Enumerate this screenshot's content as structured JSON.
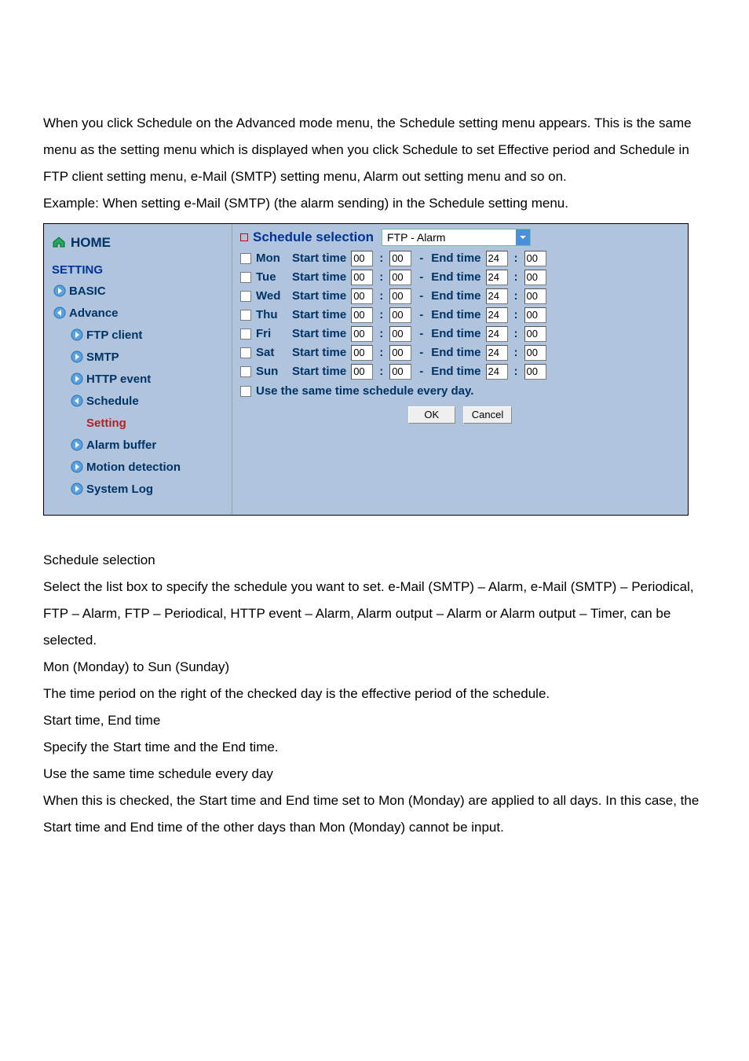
{
  "intro": {
    "p1": "When you click Schedule on the Advanced mode menu, the Schedule setting menu appears. This is the same menu as the setting menu which is displayed when you click Schedule to set Effective period and Schedule in FTP client setting menu, e-Mail (SMTP) setting menu, Alarm out setting menu and so on.",
    "p2": "Example: When setting e-Mail (SMTP) (the alarm sending) in the Schedule setting menu."
  },
  "sidebar": {
    "home": "HOME",
    "setting": "SETTING",
    "items": [
      {
        "label": "BASIC",
        "sub": false,
        "open": false,
        "current": false
      },
      {
        "label": "Advance",
        "sub": false,
        "open": true,
        "current": false
      },
      {
        "label": "FTP client",
        "sub": true,
        "open": false,
        "current": false
      },
      {
        "label": "SMTP",
        "sub": true,
        "open": false,
        "current": false
      },
      {
        "label": "HTTP event",
        "sub": true,
        "open": false,
        "current": false
      },
      {
        "label": "Schedule",
        "sub": true,
        "open": true,
        "current": false
      },
      {
        "label": "Setting",
        "sub": true,
        "open": false,
        "current": true,
        "noicon": true
      },
      {
        "label": "Alarm buffer",
        "sub": true,
        "open": false,
        "current": false
      },
      {
        "label": "Motion detection",
        "sub": true,
        "open": false,
        "current": false
      },
      {
        "label": "System Log",
        "sub": true,
        "open": false,
        "current": false
      }
    ]
  },
  "content": {
    "title": "Schedule selection",
    "dropdown_value": "FTP - Alarm",
    "start_label": "Start time",
    "end_label": "End time",
    "colon": ":",
    "dash": "-",
    "days": [
      {
        "day": "Mon",
        "sh": "00",
        "sm": "00",
        "eh": "24",
        "em": "00"
      },
      {
        "day": "Tue",
        "sh": "00",
        "sm": "00",
        "eh": "24",
        "em": "00"
      },
      {
        "day": "Wed",
        "sh": "00",
        "sm": "00",
        "eh": "24",
        "em": "00"
      },
      {
        "day": "Thu",
        "sh": "00",
        "sm": "00",
        "eh": "24",
        "em": "00"
      },
      {
        "day": "Fri",
        "sh": "00",
        "sm": "00",
        "eh": "24",
        "em": "00"
      },
      {
        "day": "Sat",
        "sh": "00",
        "sm": "00",
        "eh": "24",
        "em": "00"
      },
      {
        "day": "Sun",
        "sh": "00",
        "sm": "00",
        "eh": "24",
        "em": "00"
      }
    ],
    "same_label": "Use the same time schedule every day.",
    "ok": "OK",
    "cancel": "Cancel"
  },
  "desc": {
    "l1": "Schedule selection",
    "l2": "Select the list box to specify the schedule you want to set. e-Mail (SMTP) – Alarm, e-Mail (SMTP) – Periodical, FTP – Alarm, FTP – Periodical, HTTP event – Alarm, Alarm output – Alarm or Alarm output – Timer, can be selected.",
    "l3": "Mon (Monday) to Sun (Sunday)",
    "l4": "The time period on the right of the checked day is the effective period of the schedule.",
    "l5": "Start time, End time",
    "l6": "Specify the Start time and the End time.",
    "l7": "Use the same time schedule every day",
    "l8": "When this is checked, the Start time and End time set to Mon (Monday) are applied to all days. In this case,   the Start time and End time of the other days than Mon (Monday) cannot be input."
  }
}
